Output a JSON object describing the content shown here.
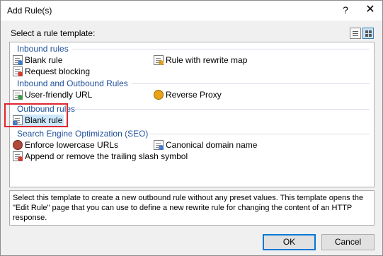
{
  "window": {
    "title": "Add Rule(s)",
    "help_glyph": "?",
    "close_glyph": "✕"
  },
  "prompt": "Select a rule template:",
  "view_buttons": [
    {
      "icon": "list-view-icon"
    },
    {
      "icon": "tile-view-icon",
      "active": true
    }
  ],
  "groups": [
    {
      "label": "Inbound rules",
      "items": [
        {
          "label": "Blank rule"
        },
        {
          "label": "Rule with rewrite map"
        },
        {
          "label": "Request blocking"
        }
      ]
    },
    {
      "label": "Inbound and Outbound Rules",
      "items": [
        {
          "label": "User-friendly URL"
        },
        {
          "label": "Reverse Proxy"
        }
      ]
    },
    {
      "label": "Outbound rules",
      "items": [
        {
          "label": "Blank rule",
          "selected": true
        }
      ]
    },
    {
      "label": "Search Engine Optimization (SEO)",
      "items": [
        {
          "label": "Enforce lowercase URLs"
        },
        {
          "label": "Canonical domain name"
        },
        {
          "label": "Append or remove the trailing slash symbol"
        }
      ]
    }
  ],
  "description": "Select this template to create a new outbound rule without any preset values. This template opens the \"Edit Rule\" page that you can use to define a new rewrite rule for changing the content of an HTTP response.",
  "buttons": {
    "ok": "OK",
    "cancel": "Cancel"
  },
  "colors": {
    "group_header": "#1e4e9a",
    "selection": "#cce8ff",
    "highlight_box": "#e0262f",
    "ok_border": "#0078d7"
  }
}
